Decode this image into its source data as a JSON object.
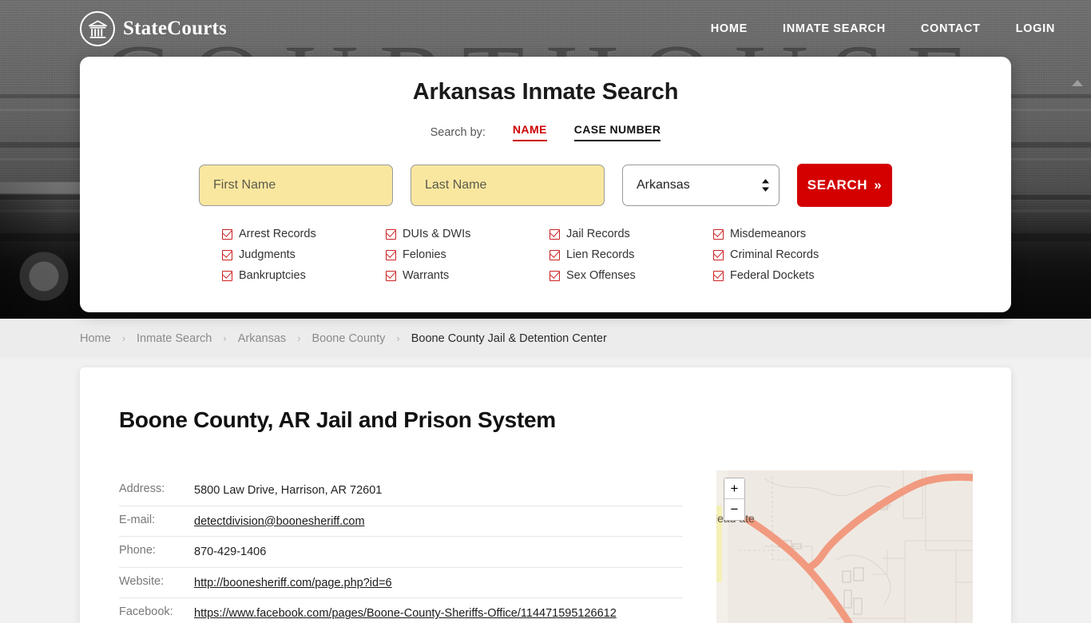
{
  "brand": {
    "name": "StateCourts",
    "icon": "courthouse-icon"
  },
  "nav": [
    {
      "label": "HOME"
    },
    {
      "label": "INMATE SEARCH"
    },
    {
      "label": "CONTACT"
    },
    {
      "label": "LOGIN"
    }
  ],
  "hero": {
    "watermark": "COURTHOUSE"
  },
  "search": {
    "title": "Arkansas Inmate Search",
    "search_by_label": "Search by:",
    "tabs": [
      {
        "label": "NAME",
        "active": true
      },
      {
        "label": "CASE NUMBER",
        "active": false
      }
    ],
    "first_name_placeholder": "First Name",
    "first_name_value": "",
    "last_name_placeholder": "Last Name",
    "last_name_value": "",
    "state_selected": "Arkansas",
    "button_label": "SEARCH",
    "button_chevron": "»",
    "accent_color": "#d40000",
    "field_fill": "#fae79f",
    "checkboxes": [
      "Arrest Records",
      "DUIs & DWIs",
      "Jail Records",
      "Misdemeanors",
      "Judgments",
      "Felonies",
      "Lien Records",
      "Criminal Records",
      "Bankruptcies",
      "Warrants",
      "Sex Offenses",
      "Federal Dockets"
    ]
  },
  "breadcrumb": {
    "items": [
      "Home",
      "Inmate Search",
      "Arkansas",
      "Boone County"
    ],
    "current": "Boone County Jail & Detention Center",
    "separator": "›"
  },
  "page": {
    "title": "Boone County, AR Jail and Prison System",
    "info": [
      {
        "label": "Address:",
        "value": "5800 Law Drive, Harrison, AR 72601",
        "link": false
      },
      {
        "label": "E-mail:",
        "value": "detectdivision@boonesheriff.com",
        "link": true
      },
      {
        "label": "Phone:",
        "value": "870-429-1406",
        "link": false
      },
      {
        "label": "Website:",
        "value": "http://boonesheriff.com/page.php?id=6",
        "link": true
      },
      {
        "label": "Facebook:",
        "value": "https://www.facebook.com/pages/Boone-County-Sheriffs-Office/114471595126612",
        "link": true
      }
    ]
  },
  "map": {
    "zoom_in_label": "+",
    "zoom_out_label": "−",
    "visible_place_label": "lead ate"
  }
}
